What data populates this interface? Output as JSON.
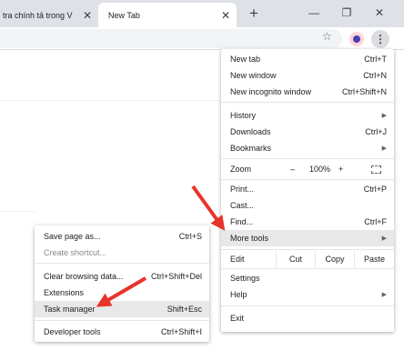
{
  "tabs": [
    {
      "label": "tra chính tả trong V",
      "close": "✕"
    },
    {
      "label": "New Tab",
      "close": "✕"
    }
  ],
  "window": {
    "new_tab_glyph": "+",
    "minimize": "—",
    "maximize": "❐",
    "close": "✕"
  },
  "toolbar": {
    "star_glyph": "☆",
    "menu_glyph": "⋮"
  },
  "main_menu": {
    "new_tab": {
      "label": "New tab",
      "shortcut": "Ctrl+T"
    },
    "new_window": {
      "label": "New window",
      "shortcut": "Ctrl+N"
    },
    "new_incognito": {
      "label": "New incognito window",
      "shortcut": "Ctrl+Shift+N"
    },
    "history": {
      "label": "History",
      "arrow": "▶"
    },
    "downloads": {
      "label": "Downloads",
      "shortcut": "Ctrl+J"
    },
    "bookmarks": {
      "label": "Bookmarks",
      "arrow": "▶"
    },
    "zoom": {
      "label": "Zoom",
      "minus": "–",
      "level": "100%",
      "plus": "+"
    },
    "print": {
      "label": "Print...",
      "shortcut": "Ctrl+P"
    },
    "cast": {
      "label": "Cast..."
    },
    "find": {
      "label": "Find...",
      "shortcut": "Ctrl+F"
    },
    "more_tools": {
      "label": "More tools",
      "arrow": "▶"
    },
    "edit": {
      "label": "Edit",
      "cut": "Cut",
      "copy": "Copy",
      "paste": "Paste"
    },
    "settings": {
      "label": "Settings"
    },
    "help": {
      "label": "Help",
      "arrow": "▶"
    },
    "exit": {
      "label": "Exit"
    }
  },
  "sub_menu": {
    "save_page": {
      "label": "Save page as...",
      "shortcut": "Ctrl+S"
    },
    "create_shortcut": {
      "label": "Create shortcut..."
    },
    "clear_data": {
      "label": "Clear browsing data...",
      "shortcut": "Ctrl+Shift+Del"
    },
    "extensions": {
      "label": "Extensions"
    },
    "task_manager": {
      "label": "Task manager",
      "shortcut": "Shift+Esc"
    },
    "developer_tools": {
      "label": "Developer tools",
      "shortcut": "Ctrl+Shift+I"
    }
  },
  "colors": {
    "arrow": "#e8342a",
    "highlight": "#e8e8e8",
    "tabbar": "#dee1e6"
  }
}
